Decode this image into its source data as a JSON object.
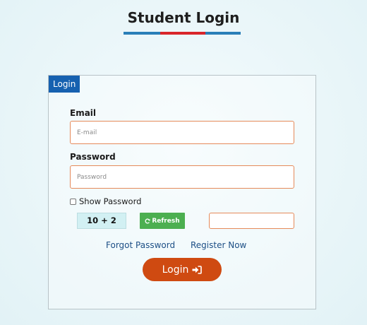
{
  "page": {
    "title": "Student Login"
  },
  "panel": {
    "tab_label": "Login"
  },
  "form": {
    "email_label": "Email",
    "email_placeholder": "E-mail",
    "password_label": "Password",
    "password_placeholder": "Password",
    "show_password_label": "Show Password",
    "captcha_text": "10 + 2",
    "refresh_label": "Refresh",
    "captcha_value": ""
  },
  "links": {
    "forgot": "Forgot Password",
    "register": "Register Now"
  },
  "submit": {
    "label": "Login",
    "icon": "sign-in-icon"
  },
  "colors": {
    "tab_blue": "#1661b0",
    "accent_red": "#d9262b",
    "button_orange": "#cf4a11",
    "refresh_green": "#4caf50",
    "input_border": "#e58a5a"
  }
}
